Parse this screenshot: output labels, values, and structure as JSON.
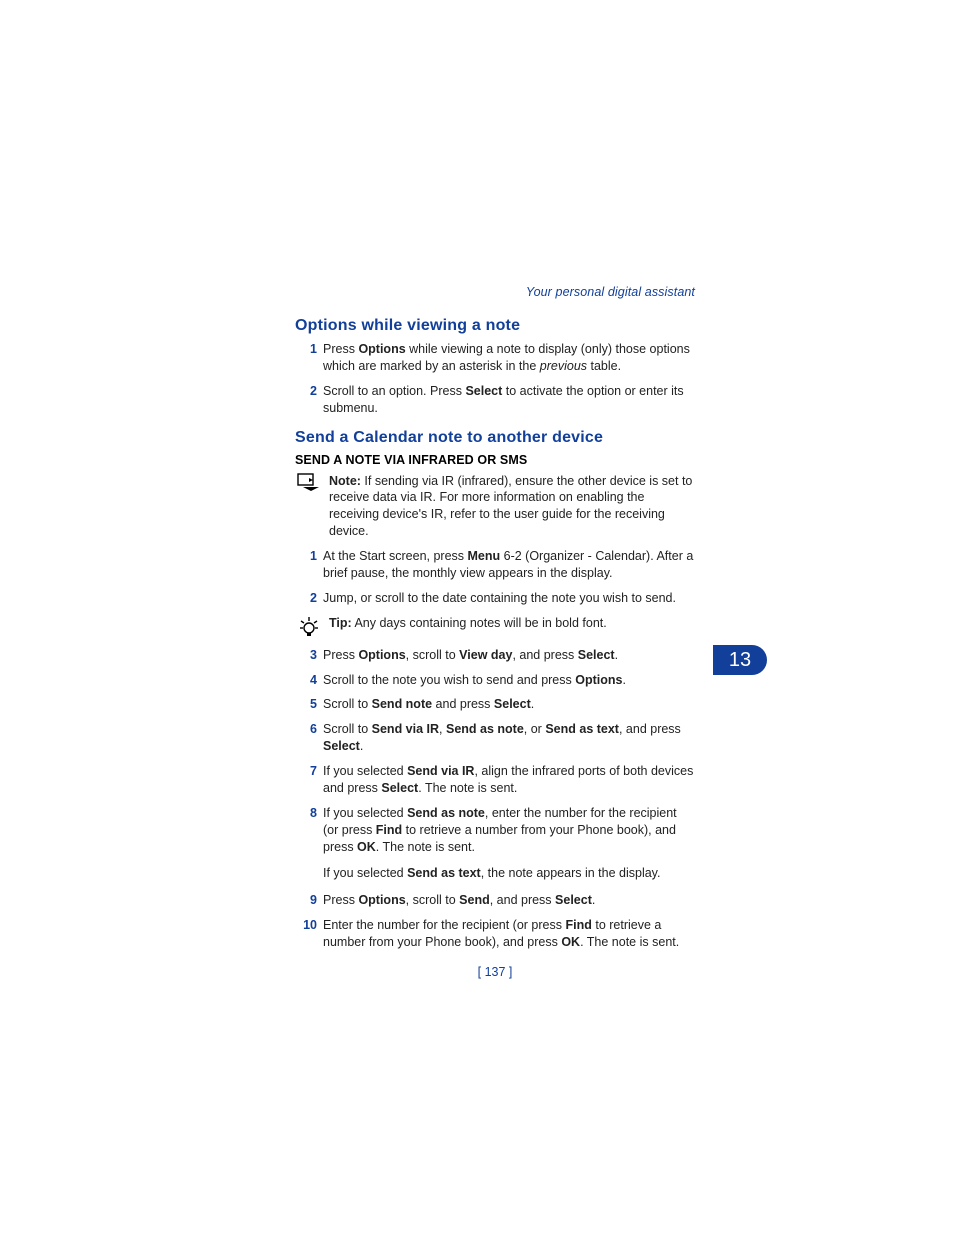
{
  "running_head": "Your personal digital assistant",
  "chapter_tab": "13",
  "page_number": "[ 137 ]",
  "section1": {
    "title": "Options while viewing a note",
    "items": [
      {
        "n": "1",
        "segs": [
          {
            "t": "Press "
          },
          {
            "t": "Options",
            "b": true
          },
          {
            "t": " while viewing a note to display (only) those options which are marked by an asterisk in the "
          },
          {
            "t": "previous",
            "i": true
          },
          {
            "t": " table."
          }
        ]
      },
      {
        "n": "2",
        "segs": [
          {
            "t": "Scroll to an option. Press "
          },
          {
            "t": "Select",
            "b": true
          },
          {
            "t": " to activate the option or enter its submenu."
          }
        ]
      }
    ]
  },
  "section2": {
    "title": "Send a Calendar note to another device",
    "subhead": "SEND A NOTE VIA INFRARED OR SMS",
    "note_callout": [
      {
        "t": "Note:",
        "b": true
      },
      {
        "t": " If sending via IR (infrared), ensure the other device is set to receive data via IR. For more information on enabling the receiving device's IR, refer to the user guide for the receiving device."
      }
    ],
    "items_a": [
      {
        "n": "1",
        "segs": [
          {
            "t": "At the Start screen, press "
          },
          {
            "t": "Menu",
            "b": true
          },
          {
            "t": " 6-2 (Organizer - Calendar). After a brief pause, the monthly view appears in the display."
          }
        ]
      },
      {
        "n": "2",
        "segs": [
          {
            "t": "Jump, or scroll to the date containing the note you wish to send."
          }
        ]
      }
    ],
    "tip_callout": [
      {
        "t": "Tip:",
        "b": true
      },
      {
        "t": " Any days containing notes will be in bold font."
      }
    ],
    "items_b": [
      {
        "n": "3",
        "segs": [
          {
            "t": "Press "
          },
          {
            "t": "Options",
            "b": true
          },
          {
            "t": ", scroll to "
          },
          {
            "t": "View day",
            "b": true
          },
          {
            "t": ", and press "
          },
          {
            "t": "Select",
            "b": true
          },
          {
            "t": "."
          }
        ]
      },
      {
        "n": "4",
        "segs": [
          {
            "t": "Scroll to the note you wish to send and press "
          },
          {
            "t": "Options",
            "b": true
          },
          {
            "t": "."
          }
        ]
      },
      {
        "n": "5",
        "segs": [
          {
            "t": "Scroll to "
          },
          {
            "t": "Send note",
            "b": true
          },
          {
            "t": " and press "
          },
          {
            "t": "Select",
            "b": true
          },
          {
            "t": "."
          }
        ]
      },
      {
        "n": "6",
        "segs": [
          {
            "t": "Scroll to "
          },
          {
            "t": "Send via IR",
            "b": true
          },
          {
            "t": ", "
          },
          {
            "t": "Send as note",
            "b": true
          },
          {
            "t": ", or "
          },
          {
            "t": "Send as text",
            "b": true
          },
          {
            "t": ", and press "
          },
          {
            "t": "Select",
            "b": true
          },
          {
            "t": "."
          }
        ]
      },
      {
        "n": "7",
        "segs": [
          {
            "t": "If you selected "
          },
          {
            "t": "Send via IR",
            "b": true
          },
          {
            "t": ", align the infrared ports of both devices and press "
          },
          {
            "t": "Select",
            "b": true
          },
          {
            "t": ". The note is sent."
          }
        ]
      },
      {
        "n": "8",
        "segs": [
          {
            "t": "If you selected "
          },
          {
            "t": "Send as note",
            "b": true
          },
          {
            "t": ", enter the number for the recipient (or press "
          },
          {
            "t": "Find",
            "b": true
          },
          {
            "t": " to retrieve a number from your Phone book), and press "
          },
          {
            "t": "OK",
            "b": true
          },
          {
            "t": ". The note is sent."
          }
        ]
      }
    ],
    "after8_para": [
      {
        "t": "If you selected "
      },
      {
        "t": "Send as text",
        "b": true
      },
      {
        "t": ", the note appears in the display."
      }
    ],
    "items_c": [
      {
        "n": "9",
        "segs": [
          {
            "t": "Press "
          },
          {
            "t": "Options",
            "b": true
          },
          {
            "t": ", scroll to "
          },
          {
            "t": "Send",
            "b": true
          },
          {
            "t": ", and press "
          },
          {
            "t": "Select",
            "b": true
          },
          {
            "t": "."
          }
        ]
      },
      {
        "n": "10",
        "segs": [
          {
            "t": "Enter the number for the recipient (or press "
          },
          {
            "t": "Find",
            "b": true
          },
          {
            "t": " to retrieve a number from your Phone book), and press "
          },
          {
            "t": "OK",
            "b": true
          },
          {
            "t": ". The note is sent."
          }
        ]
      }
    ]
  }
}
